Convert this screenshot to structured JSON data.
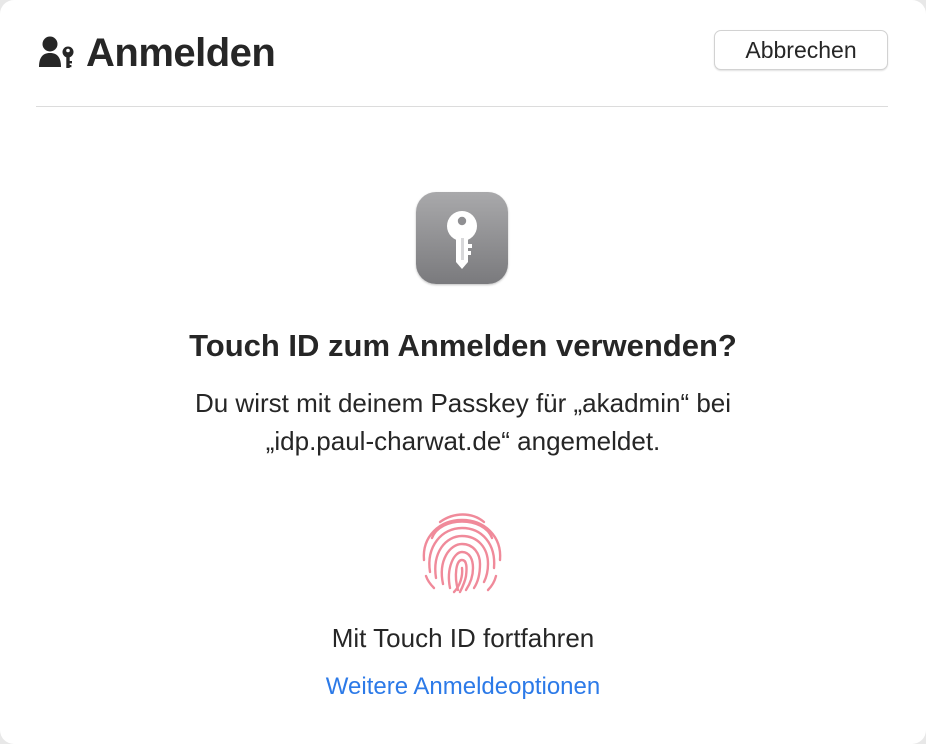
{
  "header": {
    "title": "Anmelden",
    "title_icon": "person-key-icon",
    "cancel_label": "Abbrechen"
  },
  "app_icon": "keychain-key-icon",
  "prompt": {
    "heading": "Touch ID zum Anmelden verwenden?",
    "message_line1": "Du wirst mit deinem Passkey für „akadmin“ bei",
    "message_line2": "„idp.paul-charwat.de“ angemeldet."
  },
  "touch_id": {
    "icon": "fingerprint-icon",
    "label": "Mit Touch ID fortfahren",
    "color": "#f08a9a"
  },
  "more_options_label": "Weitere Anmeldeoptionen",
  "colors": {
    "link": "#2c7ae8",
    "text": "#262626"
  }
}
